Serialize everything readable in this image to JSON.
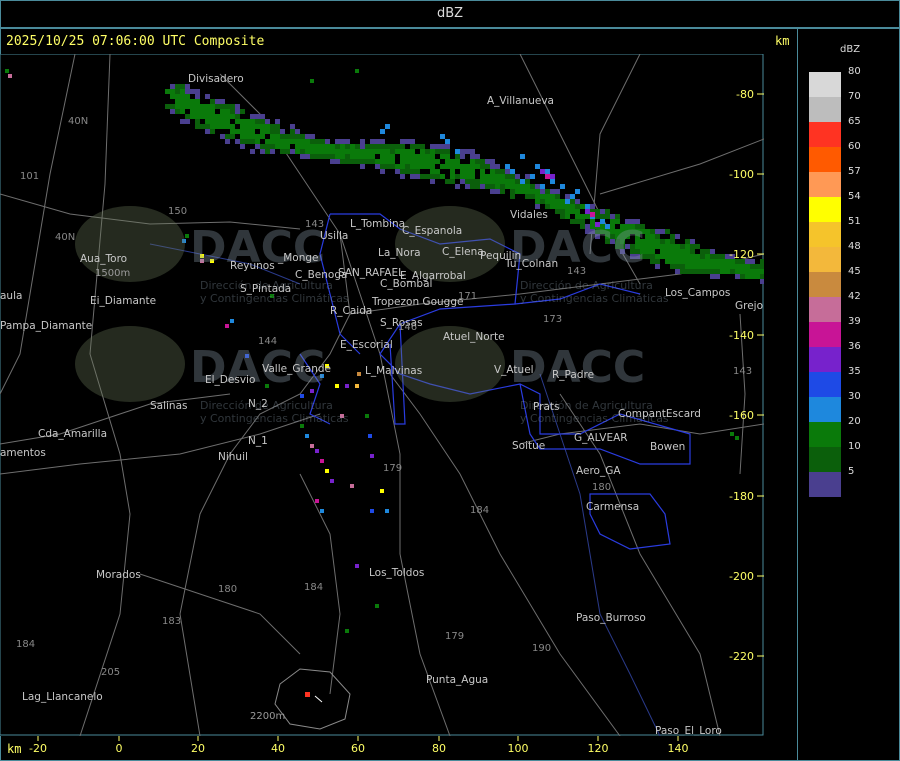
{
  "title": "dBZ",
  "header": "2025/10/25 07:06:00 UTC Composite",
  "units": "km",
  "legend": {
    "title": "dBZ",
    "entries": [
      {
        "value": "80",
        "color": "#d8d8d8"
      },
      {
        "value": "70",
        "color": "#bdbdbd"
      },
      {
        "value": "65",
        "color": "#ff3322"
      },
      {
        "value": "60",
        "color": "#ff5a00"
      },
      {
        "value": "57",
        "color": "#ff9955"
      },
      {
        "value": "54",
        "color": "#ffff00"
      },
      {
        "value": "51",
        "color": "#f5c42b"
      },
      {
        "value": "48",
        "color": "#f3b83b"
      },
      {
        "value": "45",
        "color": "#c98a3e"
      },
      {
        "value": "42",
        "color": "#c66d99"
      },
      {
        "value": "39",
        "color": "#c81496"
      },
      {
        "value": "36",
        "color": "#7722cc"
      },
      {
        "value": "35",
        "color": "#1e4ae6"
      },
      {
        "value": "30",
        "color": "#1e88dd"
      },
      {
        "value": "20",
        "color": "#0a7a0a"
      },
      {
        "value": "10",
        "color": "#0b5f0b"
      },
      {
        "value": "5",
        "color": "#4a3f8f"
      }
    ]
  },
  "axes": {
    "x_ticks": [
      "-20",
      "0",
      "20",
      "40",
      "60",
      "80",
      "100",
      "120",
      "140"
    ],
    "y_ticks": [
      "-80",
      "-100",
      "-120",
      "-140",
      "-160",
      "-180",
      "-200",
      "-220"
    ]
  },
  "places": [
    "Divisadero",
    "A_Villanueva",
    "Usilla",
    "L_Tombina",
    "C_Espanola",
    "La_Nora",
    "C_Elena",
    "Pequilin",
    "Aua_Toro",
    "Reyunos",
    "_Monge",
    "C_Benoga",
    "SAN_RAFAEL",
    "E_Algarrobal",
    "Tu_Colnan",
    "S_Pintada",
    "C_Bombal",
    "R_Caida",
    "Tropezon Gougge",
    "S_Rosas",
    "E_Escorial",
    "Atuel_Norte",
    "Valle_Grande",
    "L_Malvinas",
    "V_Atuel",
    "R_Padre",
    "El_Desvio",
    "Salinas",
    "Prats",
    "CompantEscard",
    "N_2",
    "N_1",
    "G_ALVEAR",
    "Soitue",
    "Bowen",
    "Nihuil",
    "Aero_GA",
    "Carmensa",
    "Morados",
    "Los_Toldos",
    "Paso_Burroso",
    "Cda_Amarilla",
    "Pampa_Diamante",
    "Lag_Llancanelo",
    "Punta_Agua",
    "Paso_El_Loro",
    "amentos",
    "aula",
    "Vidales",
    "Los_Campos",
    "Grejo",
    "Ei_Diamante"
  ],
  "route_numbers": [
    "40N",
    "101",
    "40N",
    "150",
    "143",
    "144",
    "146",
    "171",
    "173",
    "143",
    "184",
    "180",
    "184",
    "183",
    "184",
    "205",
    "143",
    "179",
    "190",
    "180",
    "179"
  ],
  "watermark": {
    "logo": "DACC",
    "line1": "Dirección de Agricultura",
    "line2": "y Contingencias Climáticas"
  },
  "elevation_labels": [
    "1500m",
    "2200m"
  ],
  "colors": {
    "axis": "#ffff66",
    "frame": "#4a8a9a",
    "road": "#7a7a7a",
    "boundary": "#2a3ce0",
    "place": "#c8c8c8",
    "route": "#888888"
  }
}
